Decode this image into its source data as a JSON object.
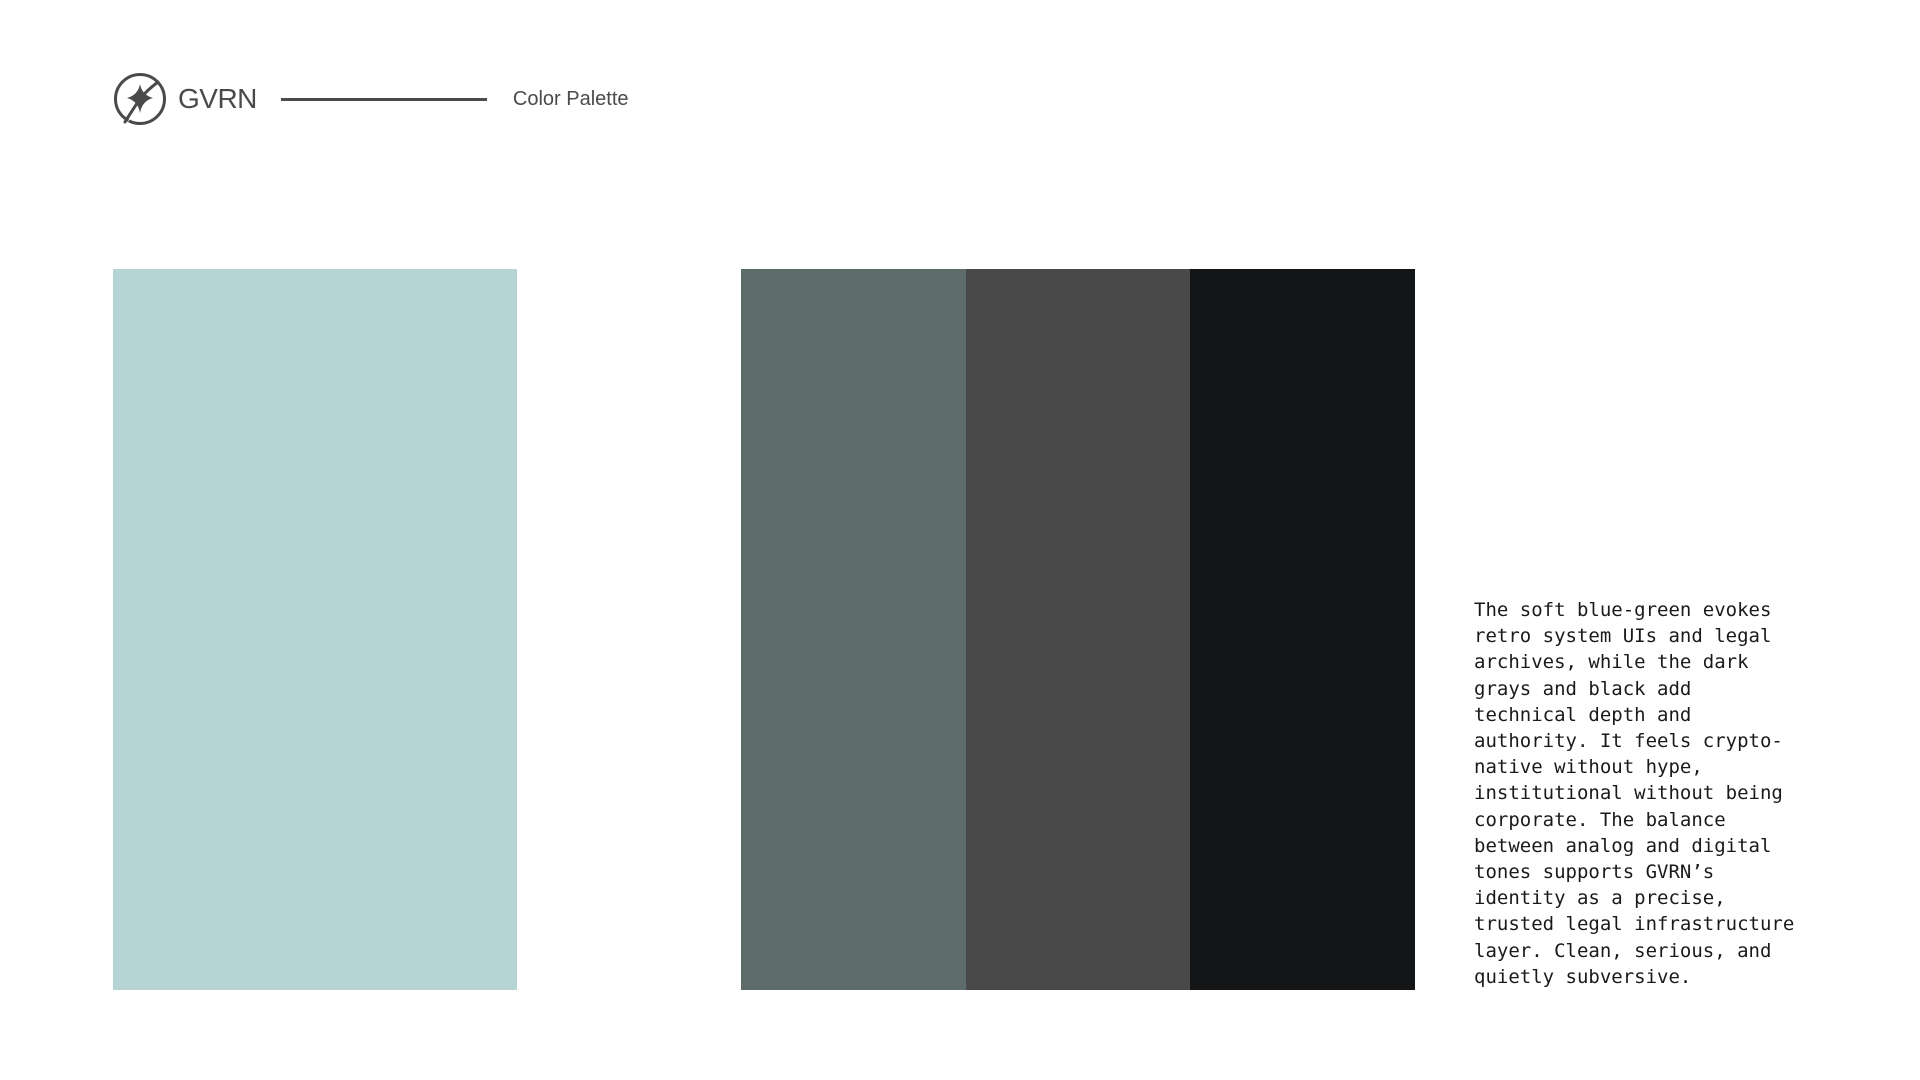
{
  "header": {
    "logo_icon": "gvrn-compass-star-icon",
    "brand": "GVRN",
    "section_title": "Color Palette"
  },
  "palette": {
    "primary": {
      "color": "#b6d4d3"
    },
    "secondary": [
      {
        "color": "#5d6b6a"
      },
      {
        "color": "#494949"
      },
      {
        "color": "#141516"
      }
    ]
  },
  "description": "The soft blue-green evokes\nretro system UIs and legal\narchives, while the dark\ngrays and black add\ntechnical depth and\nauthority. It feels crypto-\nnative without hype,\ninstitutional without being\ncorporate. The balance\nbetween analog and digital\ntones supports GVRN’s\nidentity as a precise,\ntrusted legal infrastructure\nlayer. Clean, serious, and\nquietly subversive."
}
